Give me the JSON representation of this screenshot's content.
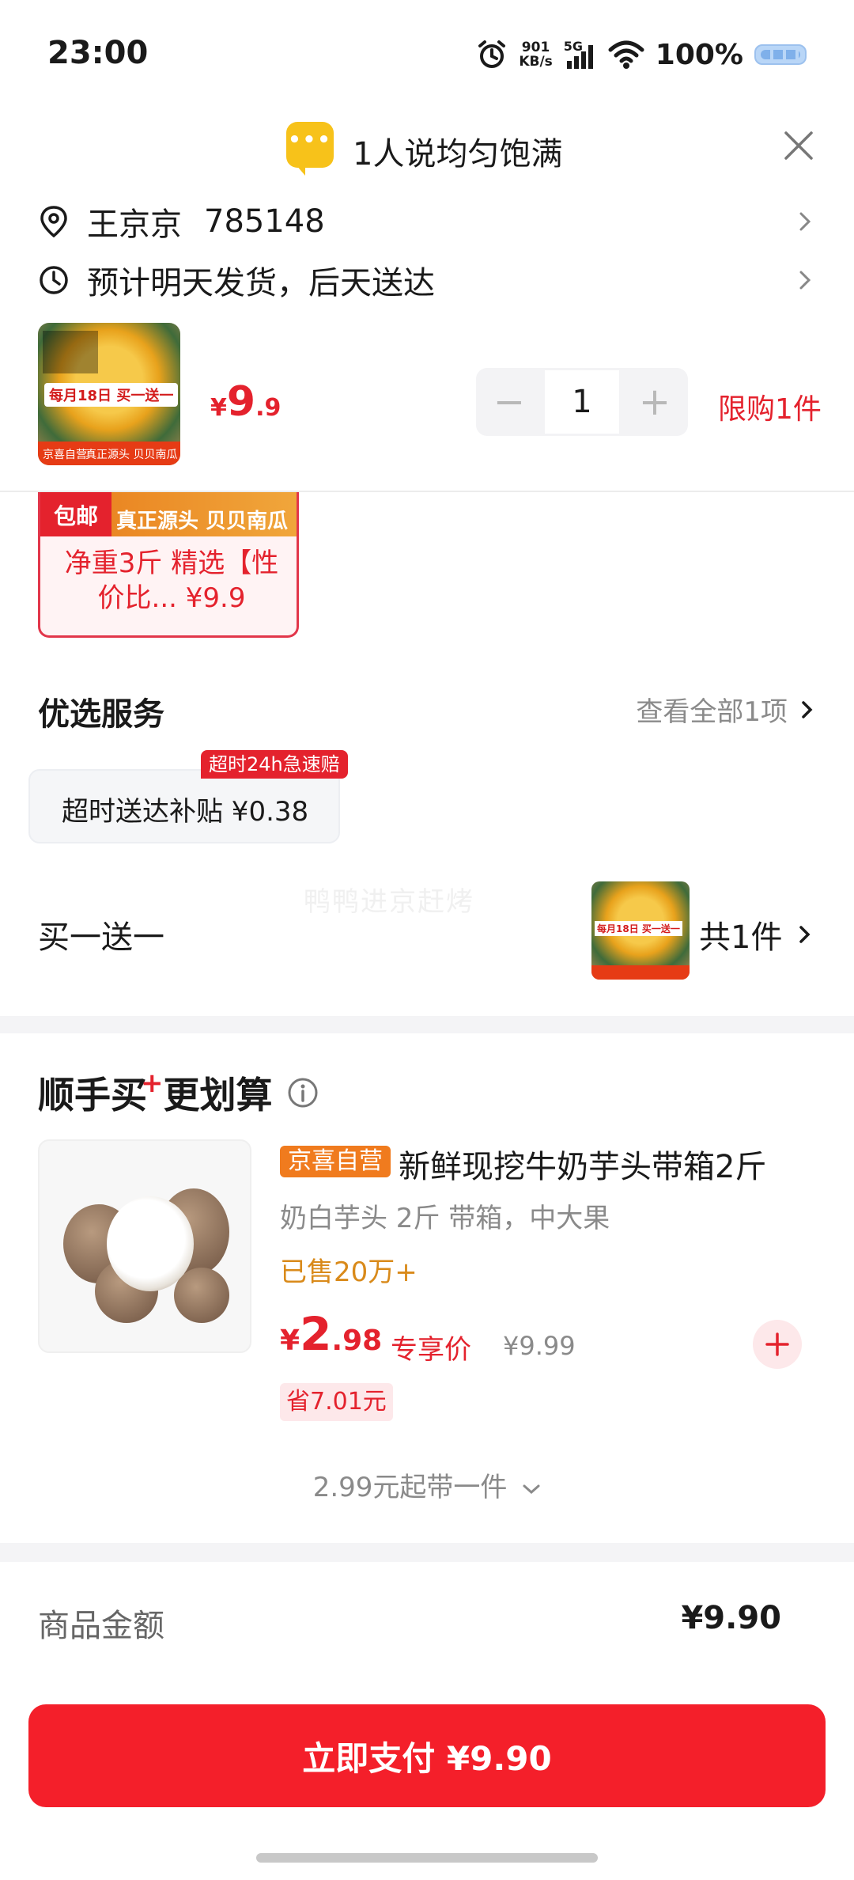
{
  "status_bar": {
    "time": "23:00",
    "net_speed": "901",
    "net_unit": "KB/s",
    "network": "5G",
    "battery": "100%"
  },
  "message": {
    "text": "1人说均匀饱满"
  },
  "address": {
    "name": "王京京",
    "code": "785148"
  },
  "delivery": {
    "text": "预计明天发货，后天送达"
  },
  "product": {
    "price_yen": "¥",
    "price_int": "9",
    "price_dec": ".9",
    "quantity": "1",
    "minus": "−",
    "plus": "+",
    "limit": "限购1件",
    "thumb_tag": "每月18日 买一送一",
    "thumb_bottom_left": "京喜自营",
    "thumb_bottom_right": "真正源头 贝贝南瓜"
  },
  "card": {
    "baoyou": "包邮",
    "band": "真正源头 贝贝南瓜",
    "desc": "净重3斤 精选【性价比... ¥9.9"
  },
  "services": {
    "title": "优选服务",
    "see_all": "查看全部1项",
    "badge": "超时24h急速赔",
    "chip": "超时送达补贴  ¥0.38"
  },
  "bogo": {
    "title": "买一送一",
    "watermark": "鸭鸭进京赶烤",
    "count": "共1件",
    "thumb_tag": "每月18日 买一送一"
  },
  "addon": {
    "title_a": "顺手买",
    "title_plus": "+",
    "title_b": "更划算",
    "badge": "京喜自营",
    "name": "新鲜现挖牛奶芋头带箱2斤",
    "spec": "奶白芋头 2斤 带箱，中大果",
    "sold": "已售20万+",
    "price_yen": "¥",
    "price_int": "2",
    "price_dec": ".98",
    "exclusive": "专享价",
    "original": "¥9.99",
    "save": "省7.01元",
    "more": "2.99元起带一件"
  },
  "total": {
    "label": "商品金额",
    "value": "¥9.90"
  },
  "pay": {
    "label": "立即支付 ¥9.90"
  },
  "colors": {
    "accent": "#e4222d",
    "pay_button": "#f41f2a",
    "orange": "#f07b1e"
  }
}
